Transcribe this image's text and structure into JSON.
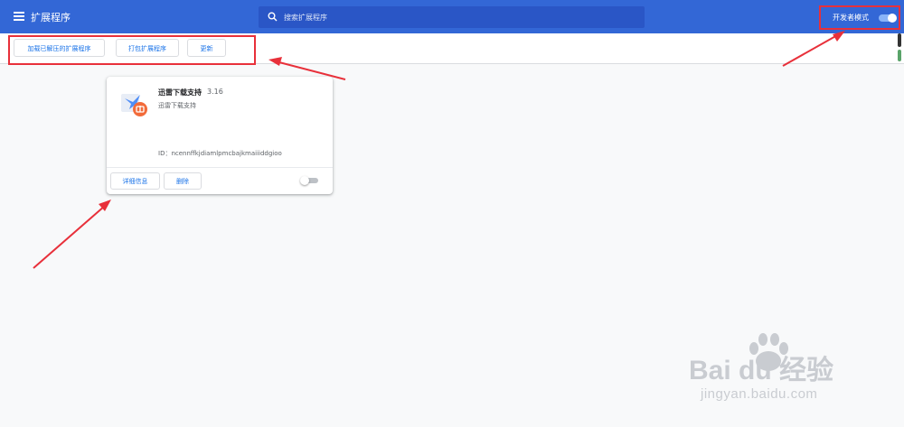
{
  "header": {
    "title": "扩展程序",
    "search_placeholder": "搜索扩展程序",
    "dev_mode_label": "开发者模式",
    "dev_mode_enabled": true
  },
  "toolbar": {
    "load_unpacked_label": "加载已解压的扩展程序",
    "pack_label": "打包扩展程序",
    "update_label": "更新"
  },
  "extension": {
    "name": "迅雷下载支持",
    "version": "3.16",
    "description": "迅雷下载支持",
    "id_text": "ID：ncennffkjdiamlpmcbajkmaiiiddgioo",
    "details_label": "详细信息",
    "remove_label": "删除",
    "enabled": false
  },
  "watermark": {
    "logo_text": "Bai du 经验",
    "url": "jingyan.baidu.com"
  },
  "colors": {
    "header_bg": "#3367d6",
    "accent": "#1a73e8",
    "annotation": "#e8303a"
  }
}
